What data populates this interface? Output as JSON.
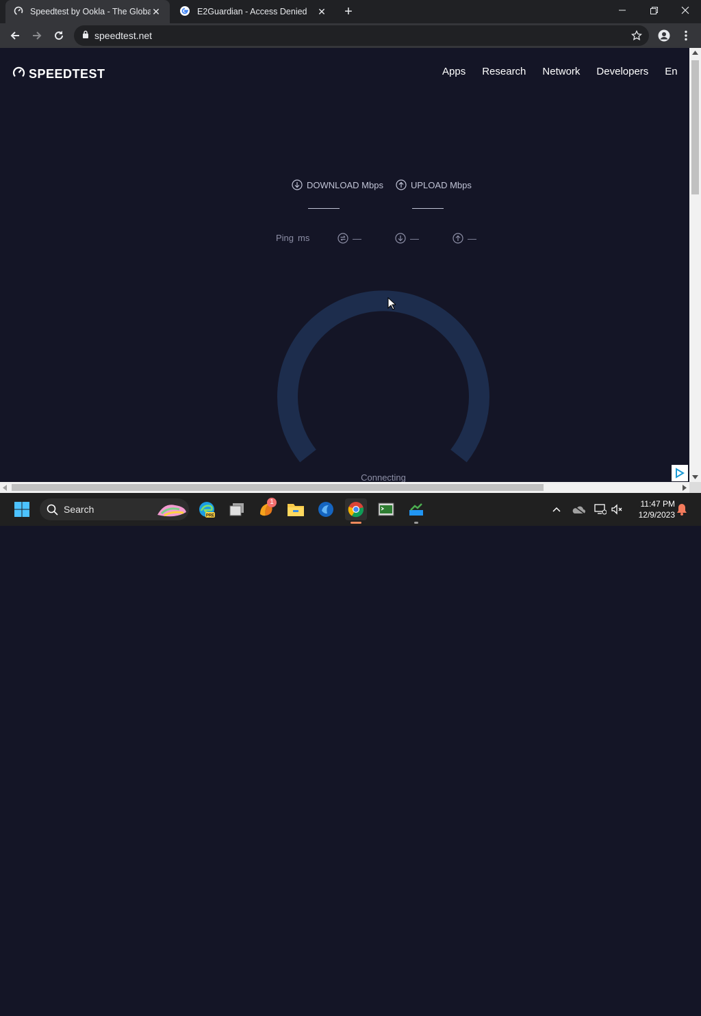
{
  "browser": {
    "tabs": [
      {
        "title": "Speedtest by Ookla - The Global",
        "close": "✕"
      },
      {
        "title": "E2Guardian - Access Denied",
        "close": "✕"
      }
    ],
    "new_tab": "+",
    "window_controls": {
      "minimize": "—",
      "restore": "❐",
      "close": "✕"
    },
    "url": "speedtest.net"
  },
  "page": {
    "logo": "SPEEDTEST",
    "nav": [
      "Apps",
      "Research",
      "Network",
      "Developers",
      "En"
    ],
    "download_label": "DOWNLOAD Mbps",
    "upload_label": "UPLOAD Mbps",
    "ping_label": "Ping",
    "ping_unit": "ms",
    "ping_values": [
      "—",
      "—",
      "—"
    ],
    "status": "Connecting"
  },
  "taskbar": {
    "search_label": "Search",
    "notification_badge": "1",
    "time": "11:47 PM",
    "date": "12/9/2023"
  },
  "colors": {
    "page_bg": "#141526",
    "gauge_track": "#1d2d4d",
    "accent_chrome": "#e8eaed"
  }
}
